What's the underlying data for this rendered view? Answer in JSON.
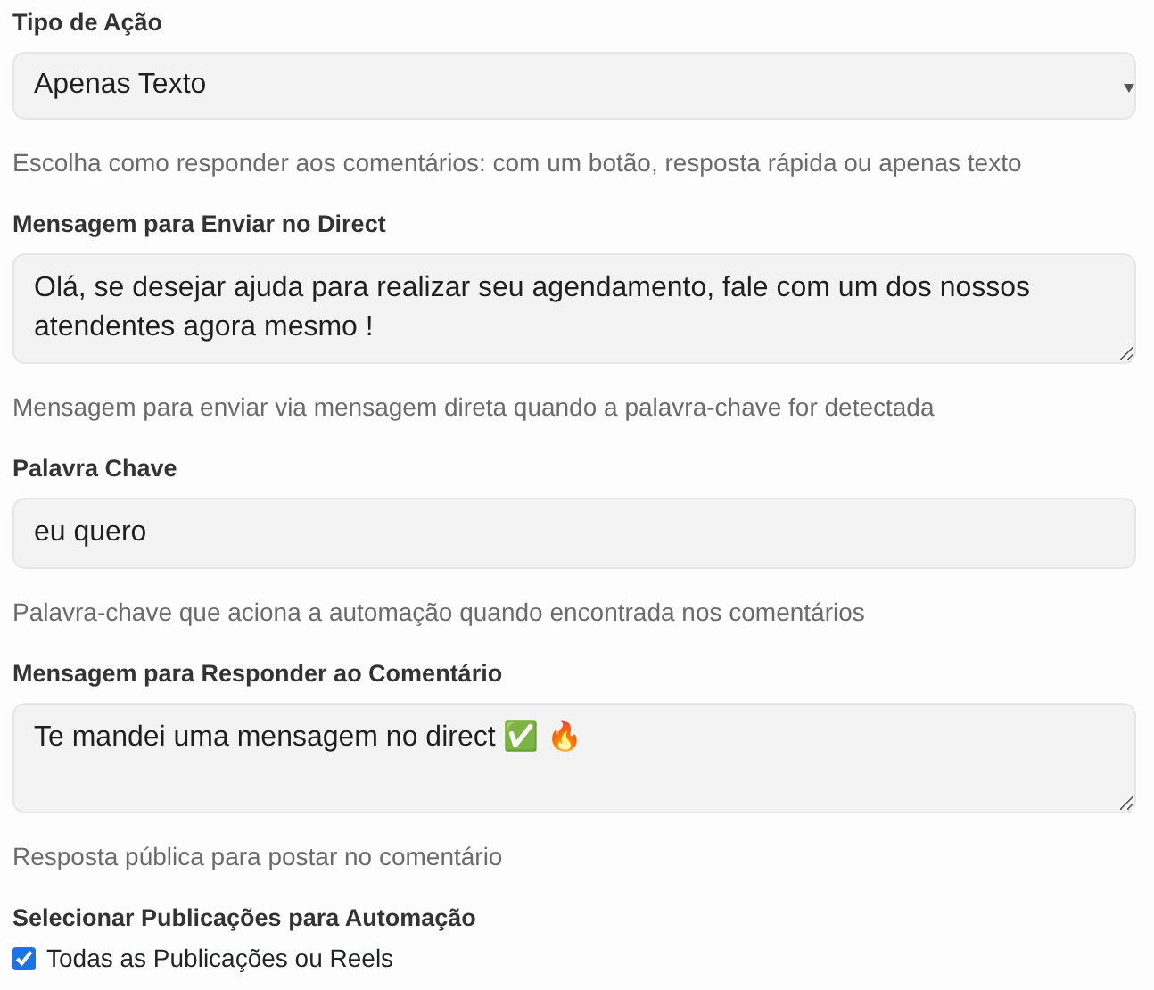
{
  "fields": [
    {
      "kind": "select",
      "label": "Tipo de Ação",
      "value": "Apenas Texto",
      "help": "Escolha como responder aos comentários: com um botão, resposta rápida ou apenas texto"
    },
    {
      "kind": "textarea",
      "label": "Mensagem para Enviar no Direct",
      "value": "Olá, se desejar ajuda para realizar seu agendamento, fale com um dos nossos atendentes agora mesmo !",
      "help": "Mensagem para enviar via mensagem direta quando a palavra-chave for detectada"
    },
    {
      "kind": "input",
      "label": "Palavra Chave",
      "value": "eu quero",
      "help": "Palavra-chave que aciona a automação quando encontrada nos comentários"
    },
    {
      "kind": "textarea",
      "label": "Mensagem para Responder ao Comentário",
      "value": "Te mandei uma mensagem no direct ✅ 🔥",
      "help": "Resposta pública para postar no comentário"
    },
    {
      "kind": "checkboxes",
      "label": "Selecionar Publicações para Automação",
      "options": [
        {
          "label": "Todas as Publicações ou Reels",
          "checked": true
        }
      ]
    }
  ]
}
